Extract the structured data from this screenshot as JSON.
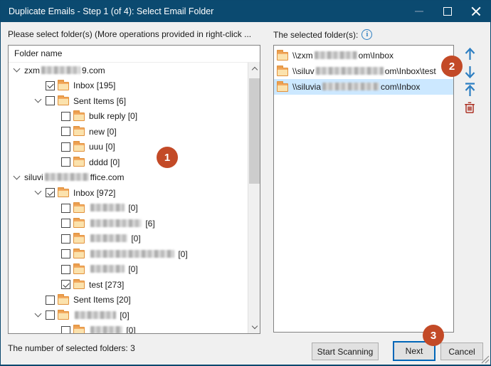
{
  "window": {
    "title": "Duplicate Emails - Step 1 (of 4): Select Email Folder"
  },
  "left_panel": {
    "instruction": "Please select folder(s) (More operations provided in right-click ...",
    "header": "Folder name",
    "rows": [
      {
        "level": 0,
        "chevron": true,
        "checkbox": null,
        "folder": false,
        "prefix": "zxm",
        "blur": 55,
        "suffix": "9.com"
      },
      {
        "level": 1,
        "chevron": false,
        "checkbox": "checked",
        "folder": true,
        "prefix": "Inbox [195]",
        "blur": 0,
        "suffix": ""
      },
      {
        "level": 1,
        "chevron": true,
        "checkbox": "unchecked",
        "folder": true,
        "prefix": "Sent Items [6]",
        "blur": 0,
        "suffix": ""
      },
      {
        "level": 2,
        "chevron": false,
        "checkbox": "unchecked",
        "folder": true,
        "prefix": "bulk reply [0]",
        "blur": 0,
        "suffix": ""
      },
      {
        "level": 2,
        "chevron": false,
        "checkbox": "unchecked",
        "folder": true,
        "prefix": "new [0]",
        "blur": 0,
        "suffix": ""
      },
      {
        "level": 2,
        "chevron": false,
        "checkbox": "unchecked",
        "folder": true,
        "prefix": "uuu [0]",
        "blur": 0,
        "suffix": ""
      },
      {
        "level": 2,
        "chevron": false,
        "checkbox": "unchecked",
        "folder": true,
        "prefix": "dddd [0]",
        "blur": 0,
        "suffix": ""
      },
      {
        "level": 0,
        "chevron": true,
        "checkbox": null,
        "folder": false,
        "prefix": "siluvi",
        "blur": 62,
        "suffix": "ffice.com"
      },
      {
        "level": 1,
        "chevron": true,
        "checkbox": "checked",
        "folder": true,
        "prefix": "Inbox [972]",
        "blur": 0,
        "suffix": ""
      },
      {
        "level": 2,
        "chevron": false,
        "checkbox": "unchecked",
        "folder": true,
        "prefix": "",
        "blur": 48,
        "suffix": " [0]"
      },
      {
        "level": 2,
        "chevron": false,
        "checkbox": "unchecked",
        "folder": true,
        "prefix": "",
        "blur": 72,
        "suffix": " [6]"
      },
      {
        "level": 2,
        "chevron": false,
        "checkbox": "unchecked",
        "folder": true,
        "prefix": "",
        "blur": 52,
        "suffix": " [0]"
      },
      {
        "level": 2,
        "chevron": false,
        "checkbox": "unchecked",
        "folder": true,
        "prefix": "",
        "blur": 118,
        "suffix": " [0]"
      },
      {
        "level": 2,
        "chevron": false,
        "checkbox": "unchecked",
        "folder": true,
        "prefix": "",
        "blur": 48,
        "suffix": " [0]"
      },
      {
        "level": 2,
        "chevron": false,
        "checkbox": "checked",
        "folder": true,
        "prefix": "test [273]",
        "blur": 0,
        "suffix": ""
      },
      {
        "level": 1,
        "chevron": false,
        "checkbox": "unchecked",
        "folder": true,
        "prefix": "Sent Items [20]",
        "blur": 0,
        "suffix": ""
      },
      {
        "level": 1,
        "chevron": true,
        "checkbox": "unchecked",
        "folder": true,
        "prefix": "",
        "blur": 58,
        "suffix": " [0]"
      },
      {
        "level": 2,
        "chevron": false,
        "checkbox": "unchecked",
        "folder": true,
        "prefix": "",
        "blur": 45,
        "suffix": " [0]"
      }
    ],
    "footer": "The number of selected folders: 3"
  },
  "right_panel": {
    "instruction": "The selected folder(s):",
    "info_icon_glyph": "i",
    "items": [
      {
        "prefix": "\\\\zxm",
        "blur": 60,
        "suffix": "om\\Inbox",
        "selected": false
      },
      {
        "prefix": "\\\\siluv",
        "blur": 95,
        "suffix": "om\\Inbox\\test",
        "selected": false
      },
      {
        "prefix": "\\\\siluvia",
        "blur": 80,
        "suffix": "com\\Inbox",
        "selected": true
      }
    ]
  },
  "buttons": {
    "start_scanning": "Start Scanning",
    "next": "Next",
    "cancel": "Cancel"
  },
  "annotations": {
    "first": "1",
    "second": "2",
    "third": "3"
  },
  "colors": {
    "titlebar": "#0b4a70",
    "selection": "#cce8ff",
    "annotation": "#c34a27",
    "arrow_blue": "#2e7fc2",
    "trash_red": "#a8281a",
    "folder_orange": "#e2913c"
  }
}
